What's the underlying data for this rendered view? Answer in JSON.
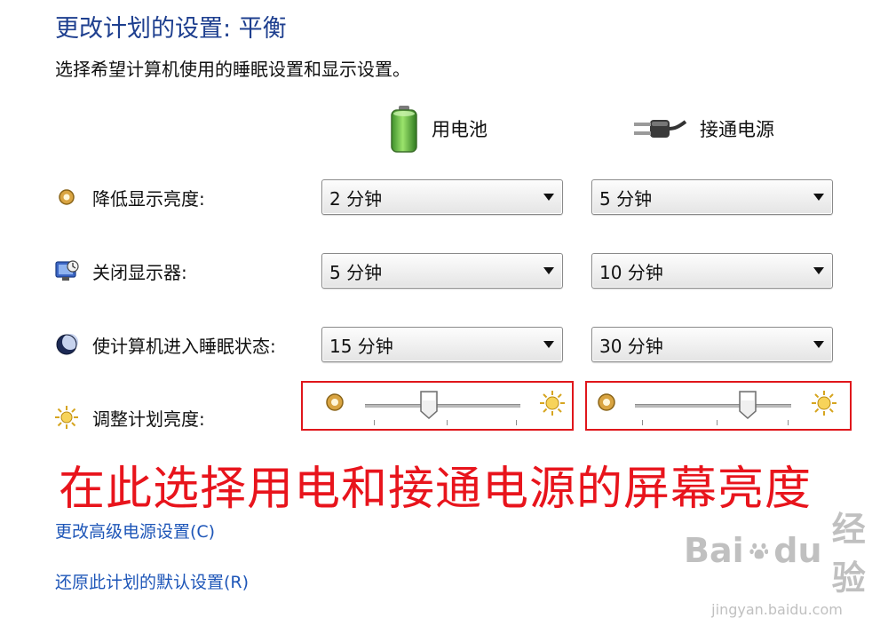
{
  "header": {
    "title": "更改计划的设置: 平衡",
    "subtitle": "选择希望计算机使用的睡眠设置和显示设置。"
  },
  "columns": {
    "battery": {
      "label": "用电池",
      "icon": "battery-icon"
    },
    "plugged": {
      "label": "接通电源",
      "icon": "power-plug-icon"
    }
  },
  "rows": [
    {
      "label": "降低显示亮度:",
      "icon": "dim-display-icon",
      "battery": "2 分钟",
      "plugged": "5 分钟"
    },
    {
      "label": "关闭显示器:",
      "icon": "monitor-off-icon",
      "battery": "5 分钟",
      "plugged": "10 分钟"
    },
    {
      "label": "使计算机进入睡眠状态:",
      "icon": "sleep-moon-icon",
      "battery": "15 分钟",
      "plugged": "30 分钟"
    }
  ],
  "brightness": {
    "label": "调整计划亮度:",
    "icon": "brightness-sun-icon",
    "battery_level": 0.41,
    "plugged_level": 0.72
  },
  "annotation": "在此选择用电和接通电源的屏幕亮度",
  "links": {
    "advanced": "更改高级电源设置(C)",
    "restore": "还原此计划的默认设置(R)"
  },
  "watermark": {
    "brand_a": "Bai",
    "brand_b": "du",
    "brand_c": "经验",
    "url": "jingyan.baidu.com"
  },
  "colors": {
    "title": "#1e3f8f",
    "link": "#1e56b8",
    "highlight_border": "#e0161b",
    "annotation": "#e8141c"
  }
}
